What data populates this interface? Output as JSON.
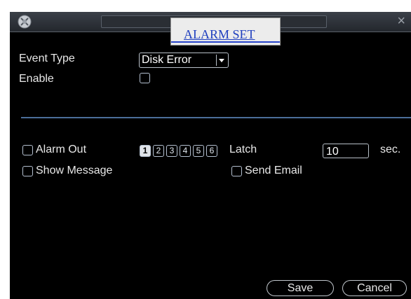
{
  "window": {
    "title": "ALARM SET",
    "close_glyph": "×",
    "logo_icon": "app-logo-icon"
  },
  "form": {
    "event_type_label": "Event Type",
    "event_type_value": "Disk Error",
    "enable_label": "Enable",
    "alarm_out_label": "Alarm Out",
    "channels": [
      "1",
      "2",
      "3",
      "4",
      "5",
      "6"
    ],
    "channel_selected": "1",
    "latch_label": "Latch",
    "latch_value": "10",
    "latch_unit": "sec.",
    "show_message_label": "Show Message",
    "send_email_label": "Send Email"
  },
  "buttons": {
    "save": "Save",
    "cancel": "Cancel"
  },
  "colors": {
    "background": "#000000",
    "text": "#e8e8e8",
    "title_link": "#1f3fbf",
    "divider": "#4b6e99"
  }
}
